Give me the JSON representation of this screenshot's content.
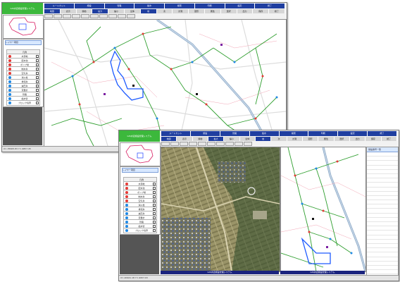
{
  "back_window": {
    "app_title": "GIS水道施設管理システム",
    "menu_row1": [
      "ルートカット",
      "施設",
      "管路",
      "給水",
      "検索",
      "印刷",
      "設定",
      "終了"
    ],
    "menu_row2": [
      "地図",
      "表示",
      "移動",
      "拡大",
      "縮小",
      "全体",
      "前",
      "次",
      "計測",
      "図形",
      "属性",
      "選択",
      "出力",
      "保存",
      "終了"
    ],
    "legend_title": "レイヤー項目",
    "legend": [
      {
        "label": "凡例",
        "color": "#ffffff"
      },
      {
        "label": "水源地",
        "color": "#e53935"
      },
      {
        "label": "配水池",
        "color": "#e53935"
      },
      {
        "label": "ポンプ場",
        "color": "#e53935"
      },
      {
        "label": "制水弁",
        "color": "#e53935"
      },
      {
        "label": "空気弁",
        "color": "#e53935"
      },
      {
        "label": "消火栓",
        "color": "#1e88e5"
      },
      {
        "label": "排泥弁",
        "color": "#1e88e5"
      },
      {
        "label": "減圧弁",
        "color": "#1e88e5"
      },
      {
        "label": "流量計",
        "color": "#1e88e5"
      },
      {
        "label": "管路",
        "color": "#1e88e5"
      },
      {
        "label": "給水管",
        "color": "#1e88e5"
      },
      {
        "label": "ブロック境界",
        "color": "#1e88e5"
      }
    ],
    "status": "X=-35605.83  Y=-9857.45"
  },
  "front_window": {
    "app_title": "GIS水道施設管理システム",
    "menu_row1": [
      "ルートカット",
      "施設",
      "管路",
      "給水",
      "検索",
      "印刷",
      "設定",
      "終了"
    ],
    "menu_row2": [
      "地図",
      "表示",
      "移動",
      "拡大",
      "縮小",
      "全体",
      "前",
      "次",
      "計測",
      "図形",
      "属性",
      "選択",
      "出力",
      "保存",
      "終了"
    ],
    "legend_title": "レイヤー項目",
    "legend": [
      {
        "label": "凡例",
        "color": "#ffffff"
      },
      {
        "label": "水源地",
        "color": "#e53935"
      },
      {
        "label": "配水池",
        "color": "#e53935"
      },
      {
        "label": "ポンプ場",
        "color": "#e53935"
      },
      {
        "label": "制水弁",
        "color": "#e53935"
      },
      {
        "label": "空気弁",
        "color": "#e53935"
      },
      {
        "label": "消火栓",
        "color": "#1e88e5"
      },
      {
        "label": "排泥弁",
        "color": "#1e88e5"
      },
      {
        "label": "減圧弁",
        "color": "#1e88e5"
      },
      {
        "label": "流量計",
        "color": "#1e88e5"
      },
      {
        "label": "管路",
        "color": "#1e88e5"
      },
      {
        "label": "給水管",
        "color": "#1e88e5"
      },
      {
        "label": "ブロック境界",
        "color": "#1e88e5"
      }
    ],
    "caption_left": "GIS水道施設管理システム",
    "caption_right": "GIS水道施設管理システム",
    "status": "X=-40921.18  Y=-9957.93",
    "right_panel_title": "施設番号一覧"
  },
  "colors": {
    "menu_blue": "#1f3ea0",
    "title_green": "#3cb83c",
    "pipe_green": "#2e9e2e",
    "highlight_blue": "#1e5bff"
  }
}
